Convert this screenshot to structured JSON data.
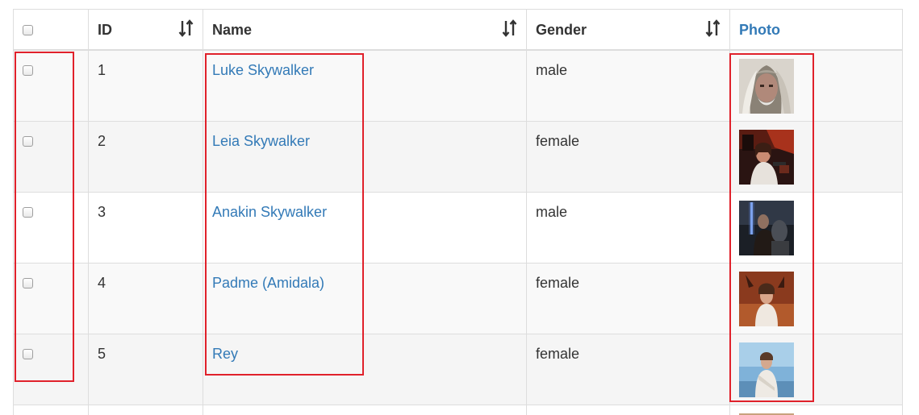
{
  "table": {
    "columns": [
      {
        "key": "select",
        "label": ""
      },
      {
        "key": "id",
        "label": "ID",
        "sortable": true
      },
      {
        "key": "name",
        "label": "Name",
        "sortable": true
      },
      {
        "key": "gender",
        "label": "Gender",
        "sortable": true
      },
      {
        "key": "photo",
        "label": "Photo"
      }
    ],
    "rows": [
      {
        "id": "1",
        "name": "Luke Skywalker",
        "gender": "male",
        "photo": "photo-luke"
      },
      {
        "id": "2",
        "name": "Leia Skywalker",
        "gender": "female",
        "photo": "photo-leia"
      },
      {
        "id": "3",
        "name": "Anakin Skywalker",
        "gender": "male",
        "photo": "photo-anakin"
      },
      {
        "id": "4",
        "name": "Padme (Amidala)",
        "gender": "female",
        "photo": "photo-padme"
      },
      {
        "id": "5",
        "name": "Rey",
        "gender": "female",
        "photo": "photo-rey"
      }
    ]
  },
  "icons": {
    "sort": "sort-icon"
  },
  "colors": {
    "link": "#337ab7",
    "highlight": "#e0212b",
    "border": "#dddddd",
    "stripe": "#f9f9f9"
  }
}
